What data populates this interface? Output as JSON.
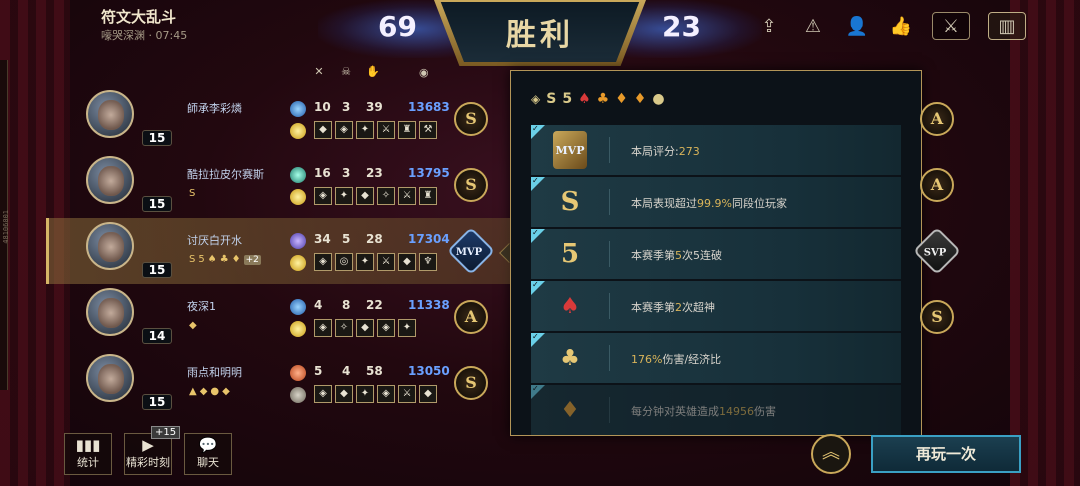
{
  "header": {
    "mode_title": "符文大乱斗",
    "mode_sub": "嚎哭深渊 · 07:45",
    "score_left": "69",
    "victory": "胜利",
    "score_right": "23"
  },
  "side_id": "48106001",
  "top_icons": [
    "share-icon",
    "report-icon",
    "add-friend-icon",
    "thumbs-up-icon",
    "team-vs-icon",
    "stats-panel-icon"
  ],
  "columns": [
    "kills-icon",
    "deaths-icon",
    "assists-icon",
    "gold-icon"
  ],
  "players": [
    {
      "name": "師承李彩燐",
      "level": "15",
      "k": "10",
      "d": "3",
      "a": "39",
      "gold": "13683",
      "grade": "S",
      "badges": [],
      "plus": ""
    },
    {
      "name": "酷拉拉皮尔赛斯",
      "level": "15",
      "k": "16",
      "d": "3",
      "a": "23",
      "gold": "13795",
      "grade": "S",
      "badges": [
        "S"
      ],
      "plus": ""
    },
    {
      "name": "讨厌白开水",
      "level": "15",
      "k": "34",
      "d": "5",
      "a": "28",
      "gold": "17304",
      "grade": "MVP",
      "badges": [
        "S",
        "5",
        "♠",
        "♣",
        "♦"
      ],
      "plus": "+2"
    },
    {
      "name": "夜深1",
      "level": "14",
      "k": "4",
      "d": "8",
      "a": "22",
      "gold": "11338",
      "grade": "A",
      "badges": [
        "◆"
      ],
      "plus": ""
    },
    {
      "name": "雨点和明明",
      "level": "15",
      "k": "5",
      "d": "4",
      "a": "58",
      "gold": "13050",
      "grade": "S",
      "badges": [
        "▲",
        "◆",
        "●",
        "◆"
      ],
      "plus": ""
    }
  ],
  "right_grades": [
    "A",
    "A",
    "SVP",
    "S",
    ""
  ],
  "popup": {
    "top_badges": [
      "◈",
      "S",
      "5",
      "♠",
      "♣",
      "♦",
      "♦",
      "●"
    ],
    "achievements": [
      {
        "icon": "MVP",
        "text": "本局评分:",
        "value": "273",
        "after": ""
      },
      {
        "icon": "S",
        "text": "本局表现超过",
        "value": "99.9%",
        "after": "同段位玩家"
      },
      {
        "icon": "5",
        "text": "本赛季第",
        "value": "5",
        "after": "次5连破"
      },
      {
        "icon": "♠",
        "text": "本赛季第",
        "value": "2",
        "after": "次超神"
      },
      {
        "icon": "♣",
        "text": "",
        "value": "176%",
        "after": "伤害/经济比"
      },
      {
        "icon": "♦",
        "text": "每分钟对英雄造成",
        "value": "14956",
        "after": "伤害"
      }
    ]
  },
  "bottom": {
    "stats_label": "统计",
    "highlights_label": "精彩时刻",
    "highlights_badge": "+15",
    "chat_label": "聊天",
    "again_label": "再玩一次"
  }
}
